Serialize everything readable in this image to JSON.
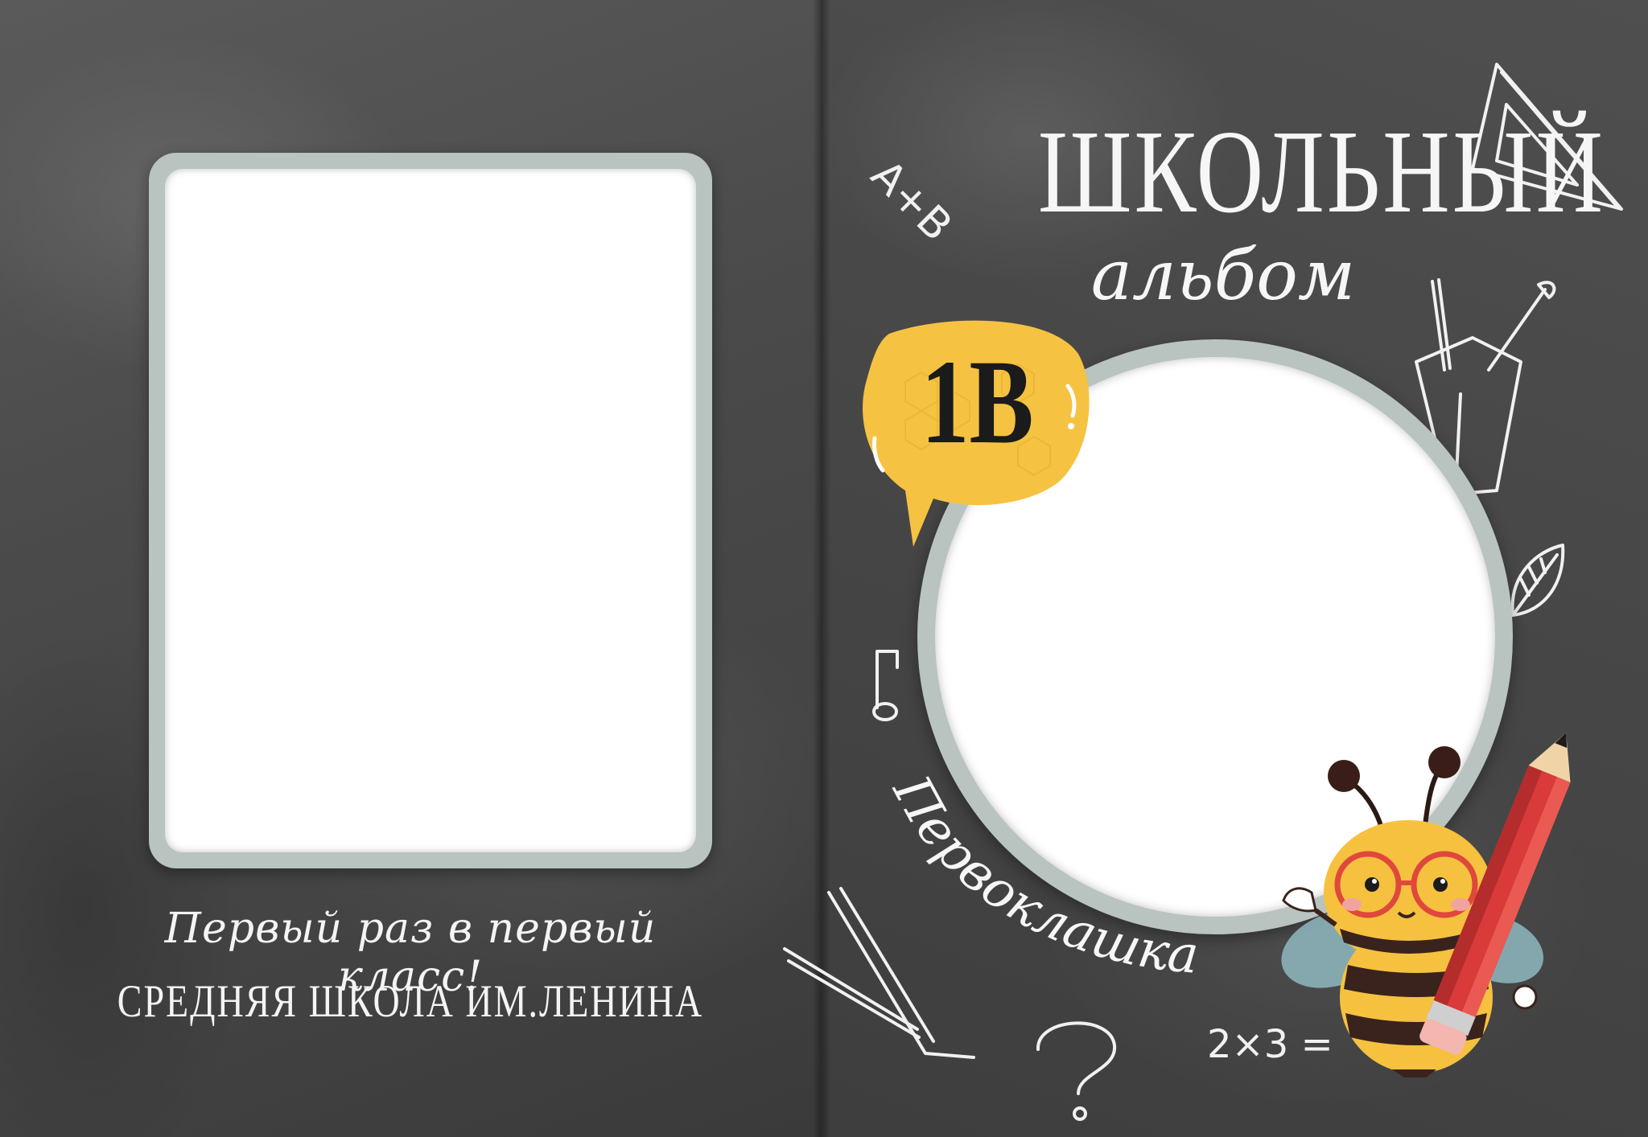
{
  "left_page": {
    "tagline": "Первый раз в первый класс!",
    "school_name": "СРЕДНЯЯ ШКОЛА ИМ.ЛЕНИНА"
  },
  "right_page": {
    "title": "ШКОЛЬНЫЙ",
    "subtitle": "альбом",
    "class_badge": "1В",
    "curved_label": "Первоклашка",
    "doodles": {
      "formula_top": "A+B",
      "formula_bottom": "2×3 =",
      "note": "♪"
    }
  },
  "colors": {
    "chalkboard": "#4a4a4a",
    "frame": "#b9c3c0",
    "badge": "#f5c242",
    "chalk": "#f1f1f1",
    "pencil": "#d93a3a"
  }
}
